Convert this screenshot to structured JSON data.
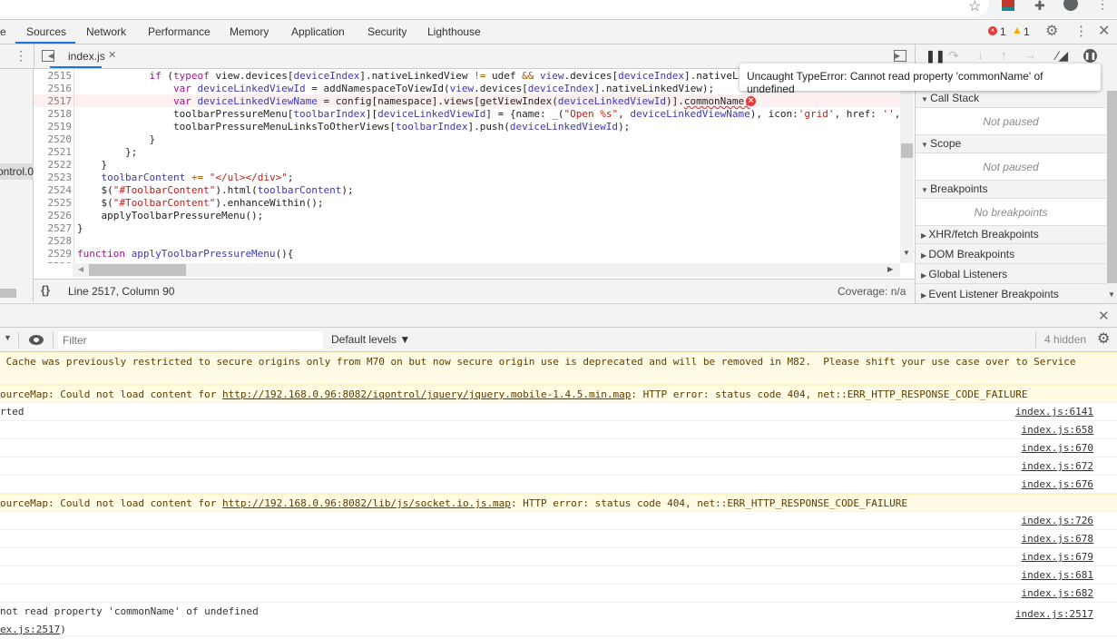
{
  "devtools": {
    "tabs": [
      "e",
      "Sources",
      "Network",
      "Performance",
      "Memory",
      "Application",
      "Security",
      "Lighthouse"
    ],
    "active_tab": "Sources",
    "error_count": "1",
    "warning_count": "1",
    "error_color": "#e53935",
    "warning_color": "#f9ab00",
    "accent": "#1a73e8"
  },
  "sources": {
    "file_tab": "index.js",
    "navigator_item": "ontrol.0",
    "lines": [
      {
        "n": "2515",
        "t": [
          [
            "            ",
            ""
          ],
          [
            "if",
            "k"
          ],
          [
            " (",
            ""
          ],
          [
            "typeof",
            "k"
          ],
          [
            " ",
            ""
          ],
          [
            "view",
            ""
          ],
          [
            ".devices[",
            ""
          ],
          [
            "deviceIndex",
            "v"
          ],
          [
            "].nativeLinkedView ",
            ""
          ],
          [
            "!=",
            "o"
          ],
          [
            " udef ",
            ""
          ],
          [
            "&&",
            "o"
          ],
          [
            " ",
            ""
          ],
          [
            "view",
            "v"
          ],
          [
            ".devices[",
            ""
          ],
          [
            "deviceIndex",
            "v"
          ],
          [
            "].nativeLi",
            ""
          ]
        ]
      },
      {
        "n": "2516",
        "t": [
          [
            "                ",
            ""
          ],
          [
            "var",
            "k"
          ],
          [
            " ",
            ""
          ],
          [
            "deviceLinkedViewId",
            "v"
          ],
          [
            " = addNamespaceToViewId(",
            ""
          ],
          [
            "view",
            "v"
          ],
          [
            ".devices[",
            ""
          ],
          [
            "deviceIndex",
            "v"
          ],
          [
            "].nativeLinkedView);",
            ""
          ]
        ]
      },
      {
        "n": "2517",
        "t": [
          [
            "                ",
            ""
          ],
          [
            "var",
            "k"
          ],
          [
            " ",
            ""
          ],
          [
            "deviceLinkedViewName",
            "v"
          ],
          [
            " = config[namespace].views[getViewIndex(",
            ""
          ],
          [
            "deviceLinkedViewId",
            "v"
          ],
          [
            ")].",
            ""
          ],
          [
            "commonName;",
            "sq"
          ]
        ]
      },
      {
        "n": "2518",
        "t": [
          [
            "                toolbarPressureMenu[",
            ""
          ],
          [
            "toolbarIndex",
            "v"
          ],
          [
            "][",
            ""
          ],
          [
            "deviceLinkedViewId",
            "v"
          ],
          [
            "] = {name: _(",
            ""
          ],
          [
            "\"Open %s\"",
            "s"
          ],
          [
            ", ",
            ""
          ],
          [
            "deviceLinkedViewName",
            "v"
          ],
          [
            "), icon:",
            ""
          ],
          [
            "'grid'",
            "s"
          ],
          [
            ", href: ",
            ""
          ],
          [
            "''",
            "s"
          ],
          [
            ",",
            ""
          ]
        ]
      },
      {
        "n": "2519",
        "t": [
          [
            "                toolbarPressureMenuLinksToOtherViews[",
            ""
          ],
          [
            "toolbarIndex",
            "v"
          ],
          [
            "].push(",
            ""
          ],
          [
            "deviceLinkedViewId",
            "v"
          ],
          [
            ");",
            ""
          ]
        ]
      },
      {
        "n": "2520",
        "t": [
          [
            "            }",
            ""
          ]
        ]
      },
      {
        "n": "2521",
        "t": [
          [
            "        };",
            ""
          ]
        ]
      },
      {
        "n": "2522",
        "t": [
          [
            "    }",
            ""
          ]
        ]
      },
      {
        "n": "2523",
        "t": [
          [
            "    ",
            ""
          ],
          [
            "toolbarContent",
            "v"
          ],
          [
            " ",
            ""
          ],
          [
            "+=",
            "o"
          ],
          [
            " ",
            ""
          ],
          [
            "\"</ul></div>\"",
            "s"
          ],
          [
            ";",
            ""
          ]
        ]
      },
      {
        "n": "2524",
        "t": [
          [
            "    $(",
            ""
          ],
          [
            "\"#ToolbarContent\"",
            "s"
          ],
          [
            ").html(",
            ""
          ],
          [
            "toolbarContent",
            "v"
          ],
          [
            ");",
            ""
          ]
        ]
      },
      {
        "n": "2525",
        "t": [
          [
            "    $(",
            ""
          ],
          [
            "\"#ToolbarContent\"",
            "s"
          ],
          [
            ").enhanceWithin();",
            ""
          ]
        ]
      },
      {
        "n": "2526",
        "t": [
          [
            "    applyToolbarPressureMenu();",
            ""
          ]
        ]
      },
      {
        "n": "2527",
        "t": [
          [
            "}",
            ""
          ]
        ]
      },
      {
        "n": "2528",
        "t": []
      },
      {
        "n": "2529",
        "t": [
          [
            "function",
            "k"
          ],
          [
            " ",
            ""
          ],
          [
            "applyToolbarPressureMenu",
            "v"
          ],
          [
            "(){",
            ""
          ]
        ]
      },
      {
        "n": "2530",
        "t": []
      }
    ],
    "error_line": "2517",
    "tooltip": "Uncaught TypeError: Cannot read property 'commonName' of undefined",
    "status_position": "Line 2517, Column 90",
    "coverage": "Coverage: n/a",
    "format_label": "{}"
  },
  "debugger": {
    "sections": [
      {
        "title": "Call Stack",
        "expanded": true,
        "body": "Not paused"
      },
      {
        "title": "Scope",
        "expanded": true,
        "body": "Not paused"
      },
      {
        "title": "Breakpoints",
        "expanded": true,
        "body": "No breakpoints"
      },
      {
        "title": "XHR/fetch Breakpoints",
        "expanded": false
      },
      {
        "title": "DOM Breakpoints",
        "expanded": false
      },
      {
        "title": "Global Listeners",
        "expanded": false
      },
      {
        "title": "Event Listener Breakpoints",
        "expanded": false
      }
    ]
  },
  "console": {
    "filter_placeholder": "Filter",
    "levels": "Default levels ▼",
    "hidden": "4 hidden",
    "messages": [
      {
        "type": "warn",
        "text": " Cache was previously restricted to secure origins only from M70 on but now secure origin use is deprecated and will be removed in M82.  Please shift your use case over to Service"
      },
      {
        "type": "warn",
        "pre": "ourceMap: Could not load content for ",
        "link": "http://192.168.0.96:8082/iqontrol/jquery/jquery.mobile-1.4.5.min.map",
        "post": ": HTTP error: status code 404, net::ERR_HTTP_RESPONSE_CODE_FAILURE"
      },
      {
        "type": "log",
        "text": "rted",
        "src": "index.js:6141"
      },
      {
        "type": "log",
        "text": "",
        "src": "index.js:658"
      },
      {
        "type": "log",
        "text": "",
        "src": "index.js:670"
      },
      {
        "type": "log",
        "text": "",
        "src": "index.js:672"
      },
      {
        "type": "log",
        "text": "",
        "src": "index.js:676"
      },
      {
        "type": "warn",
        "pre": "ourceMap: Could not load content for ",
        "link": "http://192.168.0.96:8082/lib/js/socket.io.js.map",
        "post": ": HTTP error: status code 404, net::ERR_HTTP_RESPONSE_CODE_FAILURE"
      },
      {
        "type": "log",
        "text": "",
        "src": "index.js:726"
      },
      {
        "type": "log",
        "text": "",
        "src": "index.js:678"
      },
      {
        "type": "log",
        "text": "",
        "src": "index.js:679"
      },
      {
        "type": "log",
        "text": "",
        "src": "index.js:681"
      },
      {
        "type": "log",
        "text": "",
        "src": "index.js:682"
      },
      {
        "type": "error",
        "text": "not read property 'commonName' of undefined",
        "link": "ex.js:2517",
        "post": ")",
        "src": "index.js:2517"
      }
    ]
  }
}
